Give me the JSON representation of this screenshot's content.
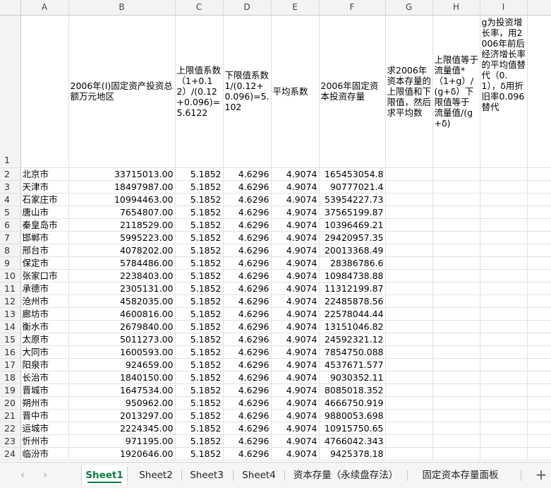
{
  "columns": [
    "A",
    "B",
    "C",
    "D",
    "E",
    "F",
    "G",
    "H",
    "I",
    ""
  ],
  "header": {
    "row_number": "1",
    "A": "",
    "B": "2006年(I)固定资产投资总额万元地区",
    "C": "上限值系数（1+0.12）/(0.12+0.096)=5.6122",
    "D": "下限值系数1/(0.12+0.096)=5.102",
    "E": "平均系数",
    "F": "2006年固定资本投资存量",
    "G": "求2006年资本存量的上限值和下限值，然后求平均数",
    "H": "上限值等于 流量值*（1+g）/(g+δ）下限值等于 流量值/(g+δ)",
    "I": "g为投资增长率，用2006年前后经济增长率的平均值替代（0.1），δ用折旧率0.096替代"
  },
  "rows": [
    {
      "n": "2",
      "a": "北京市",
      "b": "33715013.00",
      "c": "5.1852",
      "d": "4.6296",
      "e": "4.9074",
      "f": "165453054.8"
    },
    {
      "n": "3",
      "a": "天津市",
      "b": "18497987.00",
      "c": "5.1852",
      "d": "4.6296",
      "e": "4.9074",
      "f": "90777021.4"
    },
    {
      "n": "4",
      "a": "石家庄市",
      "b": "10994463.00",
      "c": "5.1852",
      "d": "4.6296",
      "e": "4.9074",
      "f": "53954227.73"
    },
    {
      "n": "5",
      "a": "唐山市",
      "b": "7654807.00",
      "c": "5.1852",
      "d": "4.6296",
      "e": "4.9074",
      "f": "37565199.87"
    },
    {
      "n": "6",
      "a": "秦皇岛市",
      "b": "2118529.00",
      "c": "5.1852",
      "d": "4.6296",
      "e": "4.9074",
      "f": "10396469.21"
    },
    {
      "n": "7",
      "a": "邯郸市",
      "b": "5995223.00",
      "c": "5.1852",
      "d": "4.6296",
      "e": "4.9074",
      "f": "29420957.35"
    },
    {
      "n": "8",
      "a": "邢台市",
      "b": "4078202.00",
      "c": "5.1852",
      "d": "4.6296",
      "e": "4.9074",
      "f": "20013368.49"
    },
    {
      "n": "9",
      "a": "保定市",
      "b": "5784486.00",
      "c": "5.1852",
      "d": "4.6296",
      "e": "4.9074",
      "f": "28386786.6"
    },
    {
      "n": "10",
      "a": "张家口市",
      "b": "2238403.00",
      "c": "5.1852",
      "d": "4.6296",
      "e": "4.9074",
      "f": "10984738.88"
    },
    {
      "n": "11",
      "a": "承德市",
      "b": "2305131.00",
      "c": "5.1852",
      "d": "4.6296",
      "e": "4.9074",
      "f": "11312199.87"
    },
    {
      "n": "12",
      "a": "沧州市",
      "b": "4582035.00",
      "c": "5.1852",
      "d": "4.6296",
      "e": "4.9074",
      "f": "22485878.56"
    },
    {
      "n": "13",
      "a": "廊坊市",
      "b": "4600816.00",
      "c": "5.1852",
      "d": "4.6296",
      "e": "4.9074",
      "f": "22578044.44"
    },
    {
      "n": "14",
      "a": "衡水市",
      "b": "2679840.00",
      "c": "5.1852",
      "d": "4.6296",
      "e": "4.9074",
      "f": "13151046.82"
    },
    {
      "n": "15",
      "a": "太原市",
      "b": "5011273.00",
      "c": "5.1852",
      "d": "4.6296",
      "e": "4.9074",
      "f": "24592321.12"
    },
    {
      "n": "16",
      "a": "大同市",
      "b": "1600593.00",
      "c": "5.1852",
      "d": "4.6296",
      "e": "4.9074",
      "f": "7854750.088"
    },
    {
      "n": "17",
      "a": "阳泉市",
      "b": "924659.00",
      "c": "5.1852",
      "d": "4.6296",
      "e": "4.9074",
      "f": "4537671.577"
    },
    {
      "n": "18",
      "a": "长治市",
      "b": "1840150.00",
      "c": "5.1852",
      "d": "4.6296",
      "e": "4.9074",
      "f": "9030352.11"
    },
    {
      "n": "19",
      "a": "晋城市",
      "b": "1647534.00",
      "c": "5.1852",
      "d": "4.6296",
      "e": "4.9074",
      "f": "8085018.352"
    },
    {
      "n": "20",
      "a": "朔州市",
      "b": "950962.00",
      "c": "5.1852",
      "d": "4.6296",
      "e": "4.9074",
      "f": "4666750.919"
    },
    {
      "n": "21",
      "a": "晋中市",
      "b": "2013297.00",
      "c": "5.1852",
      "d": "4.6296",
      "e": "4.9074",
      "f": "9880053.698"
    },
    {
      "n": "22",
      "a": "运城市",
      "b": "2224345.00",
      "c": "5.1852",
      "d": "4.6296",
      "e": "4.9074",
      "f": "10915750.65"
    },
    {
      "n": "23",
      "a": "忻州市",
      "b": "971195.00",
      "c": "5.1852",
      "d": "4.6296",
      "e": "4.9074",
      "f": "4766042.343"
    },
    {
      "n": "24",
      "a": "临汾市",
      "b": "1920646.00",
      "c": "5.1852",
      "d": "4.6296",
      "e": "4.9074",
      "f": "9425378.18"
    }
  ],
  "tabs": {
    "prev_icon": "chevron-left-icon",
    "next_icon": "chevron-right-icon",
    "sheets": [
      "Sheet1",
      "Sheet2",
      "Sheet3",
      "Sheet4",
      "资本存量（永续盘存法）",
      "固定资本存量面板"
    ],
    "active": "Sheet1",
    "add_label": "+"
  },
  "colors": {
    "accent": "#107c41",
    "header_bg": "#f3f3f3"
  }
}
